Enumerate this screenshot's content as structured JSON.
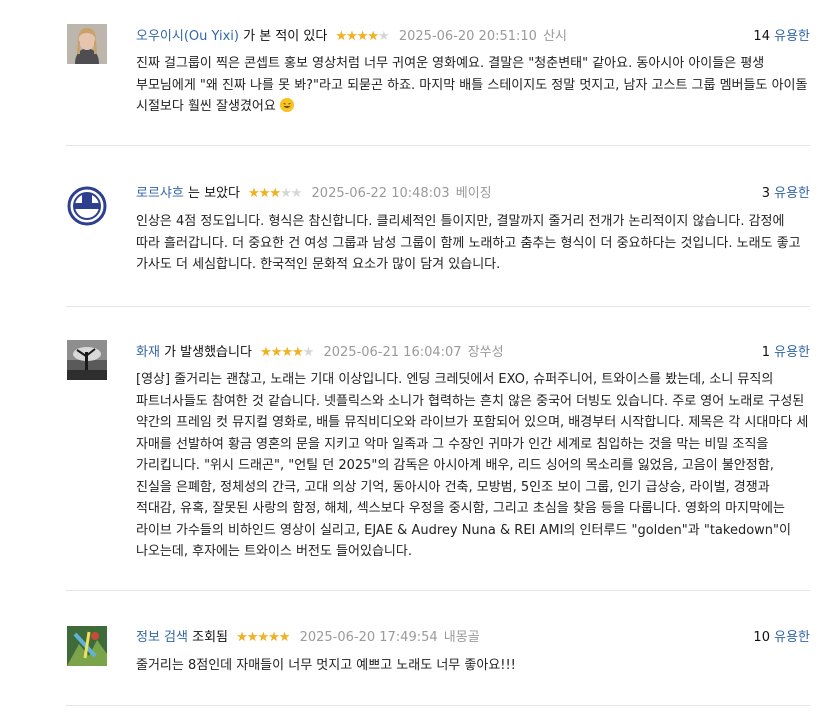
{
  "reviews": [
    {
      "user": "오우이시(Ou Yixi)",
      "action": "가 본 적이 있다",
      "rating": 4,
      "date": "2025-06-20 20:51:10",
      "location": "산시",
      "helpful_count": "14",
      "helpful_label": "유용한",
      "text": "진짜 걸그룹이 찍은 콘셉트 홍보 영상처럼 너무 귀여운 영화예요. 결말은 \"청춘변태\" 같아요. 동아시아 아이들은 평생 부모님에게 \"왜 진짜 나를 못 봐?\"라고 되묻곤 하죠. 마지막 배틀 스테이지도 정말 멋지고, 남자 고스트 그룹 멤버들도 아이돌 시절보다 훨씬 잘생겼어요",
      "emoji": "laughing-face-icon"
    },
    {
      "user": "로르샤흐",
      "action": "는 보았다",
      "rating": 3,
      "date": "2025-06-22 10:48:03",
      "location": "베이징",
      "helpful_count": "3",
      "helpful_label": "유용한",
      "text": "인상은 4점 정도입니다. 형식은 참신합니다. 클리셰적인 틀이지만, 결말까지 줄거리 전개가 논리적이지 않습니다. 감정에 따라 흘러갑니다. 더 중요한 건 여성 그룹과 남성 그룹이 함께 노래하고 춤추는 형식이 더 중요하다는 것입니다. 노래도 좋고 가사도 더 세심합니다. 한국적인 문화적 요소가 많이 담겨 있습니다."
    },
    {
      "user": "화재",
      "action": "가 발생했습니다",
      "rating": 4,
      "date": "2025-06-21 16:04:07",
      "location": "장쑤성",
      "helpful_count": "1",
      "helpful_label": "유용한",
      "text": "[영상] 줄거리는 괜찮고, 노래는 기대 이상입니다. 엔딩 크레딧에서 EXO, 슈퍼주니어, 트와이스를 봤는데, 소니 뮤직의 파트너사들도 참여한 것 같습니다. 넷플릭스와 소니가 협력하는 흔치 않은 중국어 더빙도 있습니다. 주로 영어 노래로 구성된 약간의 프레임 컷 뮤지컬 영화로, 배틀 뮤직비디오와 라이브가 포함되어 있으며, 배경부터 시작합니다. 제목은 각 시대마다 세 자매를 선발하여 황금 영혼의 문을 지키고 악마 일족과 그 수장인 귀마가 인간 세계로 침입하는 것을 막는 비밀 조직을 가리킵니다. \"위시 드래곤\", \"언틸 던 2025\"의 감독은 아시아계 배우, 리드 싱어의 목소리를 잃었음, 고음이 불안정함, 진실을 은폐함, 정체성의 간극, 고대 의상 기억, 동아시아 건축, 모방범, 5인조 보이 그룹, 인기 급상승, 라이벌, 경쟁과 적대감, 유혹, 잘못된 사랑의 함정, 해체, 섹스보다 우정을 중시함, 그리고 초심을 찾음 등을 다룹니다. 영화의 마지막에는 라이브 가수들의 비하인드 영상이 실리고, EJAE & Audrey Nuna & REI AMI의 인터루드 \"golden\"과 \"takedown\"이 나오는데, 후자에는 트와이스 버전도 들어있습니다."
    },
    {
      "user": "정보 검색",
      "action": "조회됨",
      "rating": 5,
      "date": "2025-06-20 17:49:54",
      "location": "내몽골",
      "helpful_count": "10",
      "helpful_label": "유용한",
      "text": "줄거리는 8점인데 자매들이 너무 멋지고 예쁘고 노래도 너무 좋아요!!!"
    }
  ],
  "star_glyphs": "★★★★★",
  "colors": {
    "link": "#3367a9",
    "star": "#f2b21c",
    "star_empty": "#d6d6d6",
    "meta": "#9a9a9a"
  }
}
